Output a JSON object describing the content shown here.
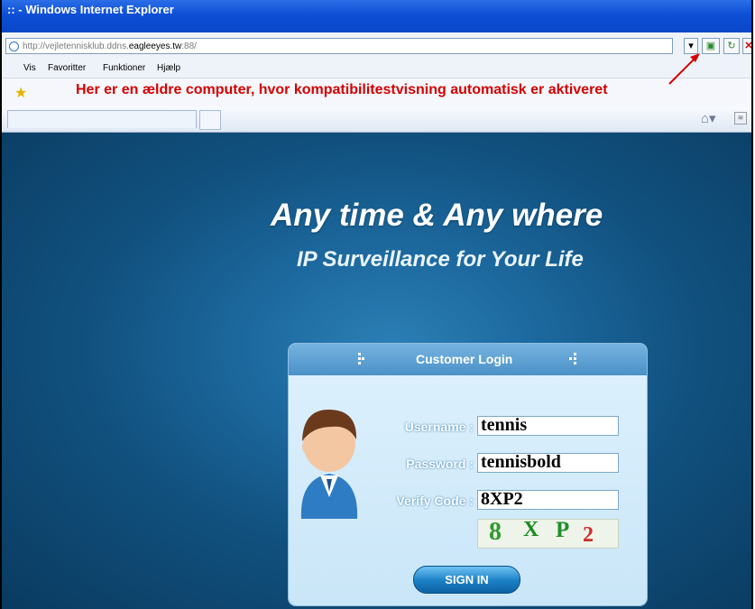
{
  "window": {
    "title": ":: - Windows Internet Explorer"
  },
  "address_bar": {
    "url_prefix": "http://vejletennisklub.ddns.",
    "url_host": "eagleeyes.tw",
    "url_suffix": ":88/"
  },
  "menu": {
    "items": [
      "Vis",
      "Favoritter",
      "Funktioner",
      "Hjælp"
    ]
  },
  "annotation": {
    "text": "Her er en ældre computer, hvor kompatibilitestvisning automatisk er aktiveret",
    "color": "#d40000"
  },
  "page": {
    "headline": "Any time & Any where",
    "subheadline": "IP Surveillance for Your Life"
  },
  "login": {
    "title": "Customer Login",
    "username_label": "Username :",
    "username_value": "tennis",
    "password_label": "Password :",
    "password_value": "tennisbold",
    "verify_label": "Verify Code :",
    "verify_value": "8XP2",
    "captcha_chars": [
      "8",
      "X",
      "P",
      "2"
    ],
    "signin_label": "SIGN IN"
  },
  "icons": [
    "ie-page-icon",
    "dropdown-icon",
    "compat-view-icon",
    "refresh-icon",
    "stop-icon",
    "favorites-star-icon",
    "home-icon",
    "feeds-icon",
    "red-arrow-icon",
    "avatar"
  ]
}
